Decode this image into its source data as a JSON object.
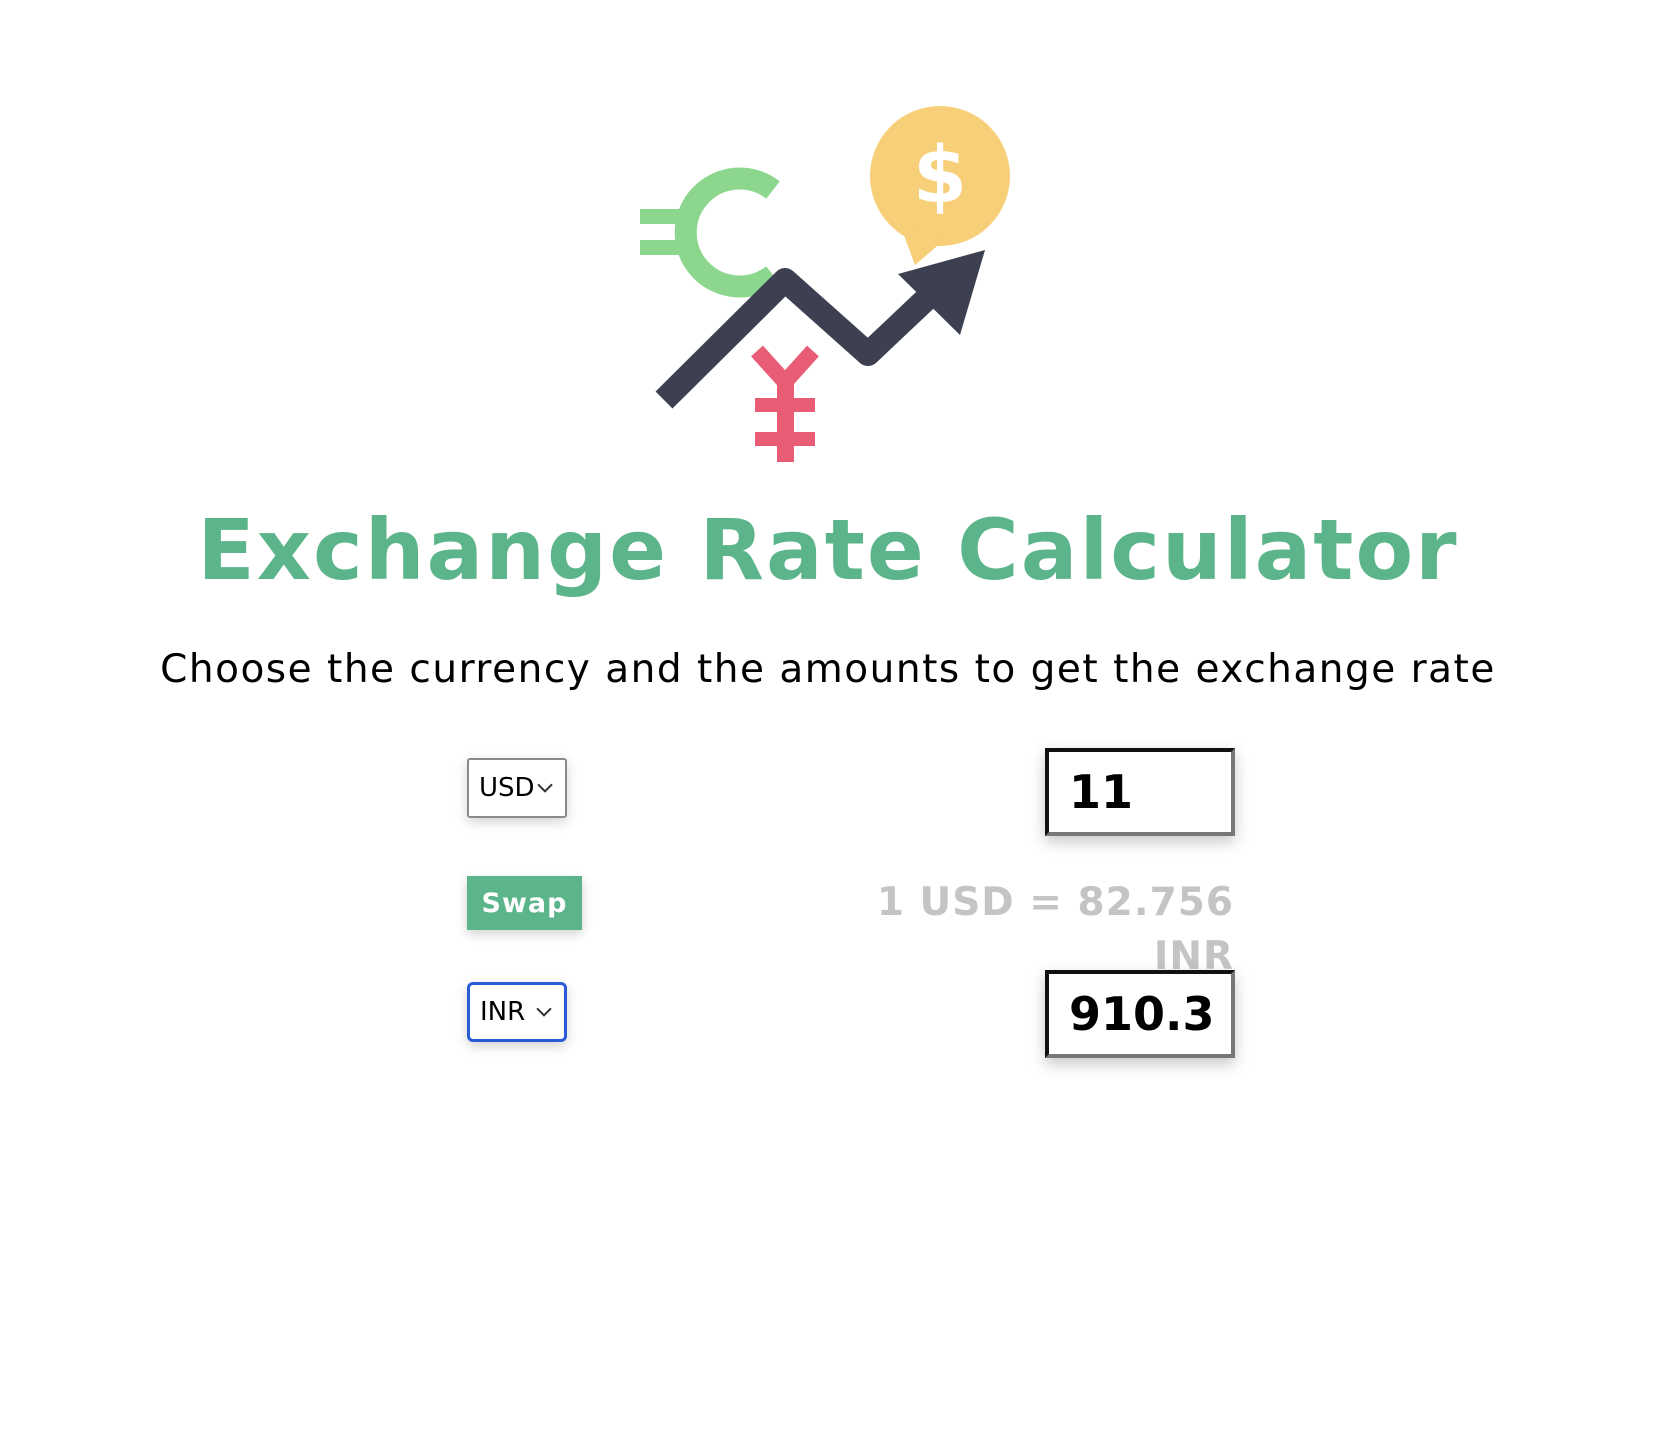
{
  "app": {
    "title": "Exchange Rate Calculator",
    "subtitle": "Choose the currency and the amounts to get the exchange rate"
  },
  "colors": {
    "accent": "#5cb58a",
    "euro": "#8dd68d",
    "dollar_bubble": "#f7cf78",
    "yen": "#e85d75",
    "arrow": "#3d4050",
    "rate_text": "#c4c4c4",
    "focus_border": "#2a5bd7"
  },
  "logo": {
    "icons": [
      "euro-icon",
      "dollar-bubble-icon",
      "yen-icon",
      "trend-arrow-icon"
    ],
    "dollar_glyph": "$"
  },
  "from": {
    "currency": "USD",
    "amount": "11"
  },
  "swap": {
    "label": "Swap"
  },
  "rate": {
    "text": "1 USD = 82.756 INR"
  },
  "to": {
    "currency": "INR",
    "amount": "910.3"
  }
}
